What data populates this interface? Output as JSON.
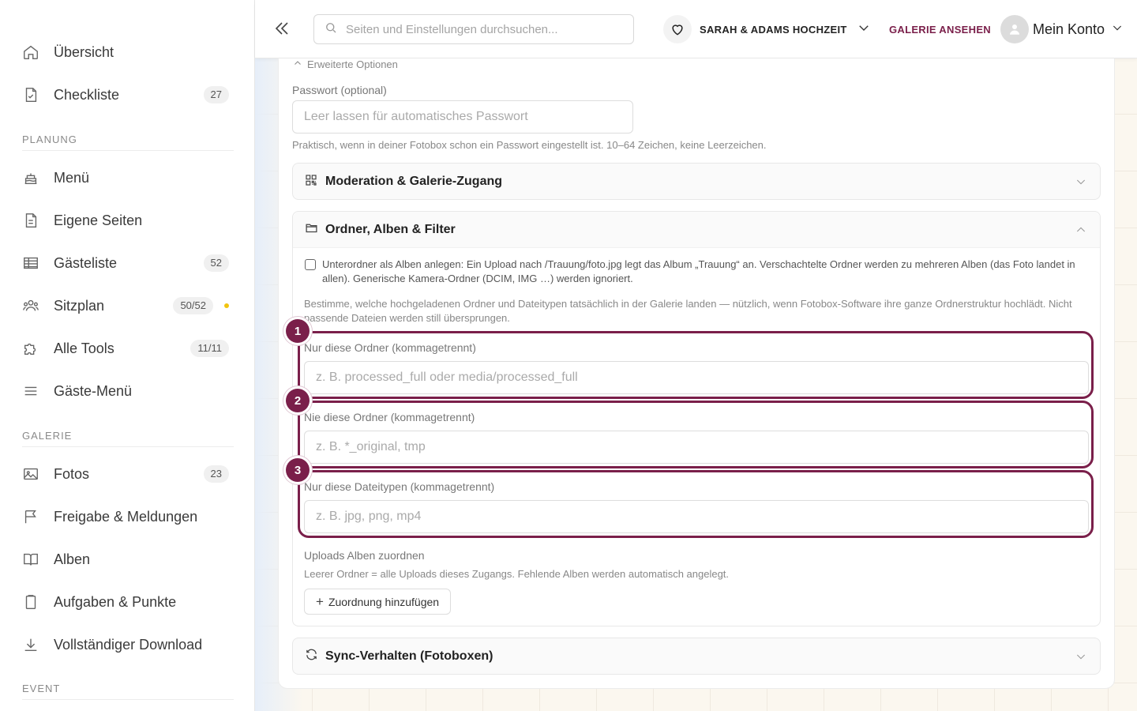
{
  "sidebar": {
    "top_items": [
      {
        "label": "Übersicht",
        "icon": "home-icon"
      },
      {
        "label": "Checkliste",
        "icon": "checklist-icon",
        "badge": "27"
      }
    ],
    "sections": [
      {
        "heading": "PLANUNG",
        "items": [
          {
            "label": "Menü",
            "icon": "cake-icon"
          },
          {
            "label": "Eigene Seiten",
            "icon": "page-icon"
          },
          {
            "label": "Gästeliste",
            "icon": "table-icon",
            "badge": "52"
          },
          {
            "label": "Sitzplan",
            "icon": "people-icon",
            "badge": "50/52"
          },
          {
            "label": "Alle Tools",
            "icon": "puzzle-icon",
            "badge": "11/11"
          },
          {
            "label": "Gäste-Menü",
            "icon": "menu-icon"
          }
        ]
      },
      {
        "heading": "GALERIE",
        "items": [
          {
            "label": "Fotos",
            "icon": "image-icon",
            "badge": "23"
          },
          {
            "label": "Freigabe & Meldungen",
            "icon": "flag-icon"
          },
          {
            "label": "Alben",
            "icon": "book-icon"
          },
          {
            "label": "Aufgaben & Punkte",
            "icon": "clipboard-icon"
          },
          {
            "label": "Vollständiger Download",
            "icon": "download-icon"
          }
        ]
      },
      {
        "heading": "EVENT",
        "items": []
      }
    ],
    "status_dot_color": "#f1c40f"
  },
  "topbar": {
    "search_placeholder": "Seiten und Einstellungen durchsuchen...",
    "event_name": "SARAH & ADAMS HOCHZEIT",
    "gallery_link": "GALERIE ANSEHEN",
    "account_label": "Mein Konto"
  },
  "main": {
    "advanced_options": "Erweiterte Optionen",
    "password_label": "Passwort (optional)",
    "password_placeholder": "Leer lassen für automatisches Passwort",
    "password_help": "Praktisch, wenn in deiner Fotobox schon ein Passwort eingestellt ist. 10–64 Zeichen, keine Leerzeichen.",
    "sections": {
      "moderation": "Moderation & Galerie-Zugang",
      "folders": "Ordner, Alben & Filter",
      "sync": "Sync-Verhalten (Fotoboxen)"
    },
    "subfolder_checkbox_text": "Unterordner als Alben anlegen: Ein Upload nach /Trauung/foto.jpg legt das Album „Trauung“ an. Verschachtelte Ordner werden zu mehreren Alben (das Foto landet in allen). Generische Kamera-Ordner (DCIM, IMG …) werden ignoriert.",
    "filter_description": "Bestimme, welche hochgeladenen Ordner und Dateitypen tatsächlich in der Galerie landen — nützlich, wenn Fotobox-Software ihre ganze Ordnerstruktur hochlädt. Nicht passende Dateien werden still übersprungen.",
    "fields": [
      {
        "marker": "1",
        "label": "Nur diese Ordner (kommagetrennt)",
        "placeholder": "z. B. processed_full oder media/processed_full"
      },
      {
        "marker": "2",
        "label": "Nie diese Ordner (kommagetrennt)",
        "placeholder": "z. B. *_original, tmp"
      },
      {
        "marker": "3",
        "label": "Nur diese Dateitypen (kommagetrennt)",
        "placeholder": "z. B. jpg, png, mp4"
      }
    ],
    "album_mapping_label": "Uploads Alben zuordnen",
    "album_mapping_help": "Leerer Ordner = alle Uploads dieses Zugangs. Fehlende Alben werden automatisch angelegt.",
    "add_mapping_button": "Zuordnung hinzufügen"
  },
  "colors": {
    "accent": "#7a1f4a"
  }
}
